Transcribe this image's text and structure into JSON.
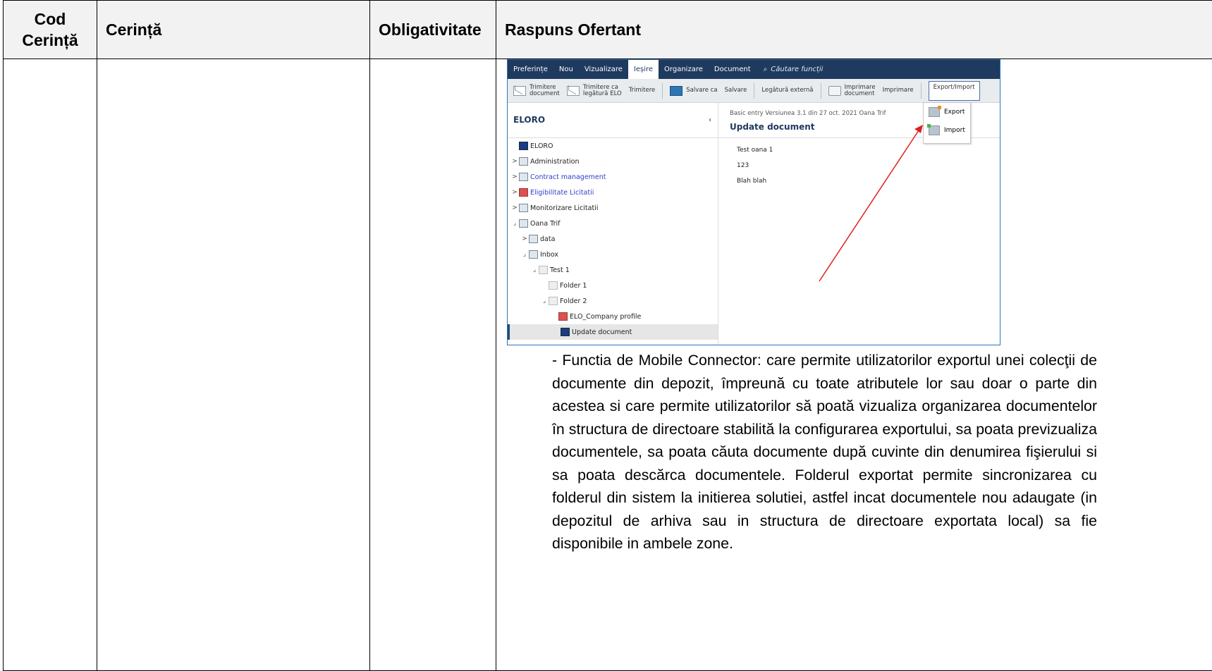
{
  "table": {
    "headers": [
      "Cod\nCerință",
      "Cerință",
      "Obligativitate",
      "Raspuns Ofertant"
    ]
  },
  "screenshot": {
    "menu": [
      "Preferințe",
      "Nou",
      "Vizualizare",
      "Ieșire",
      "Organizare",
      "Document"
    ],
    "search_placeholder": "Căutare funcții",
    "ribbon": {
      "send_doc": [
        "Trimitere",
        "document"
      ],
      "send_link": [
        "Trimitere ca",
        "legătură ELO"
      ],
      "send": "Trimitere",
      "save_as": "Salvare ca",
      "save": "Salvare",
      "ext_link": "Legătură externă",
      "print_doc": [
        "Imprimare",
        "document"
      ],
      "print": "Imprimare",
      "export_import": "Export/Import"
    },
    "dropdown": [
      "Export",
      "Import"
    ],
    "left_title": "ELORO",
    "tree": [
      {
        "label": "ELORO",
        "indent": 0,
        "arrow": "",
        "icon": "blue",
        "link": false
      },
      {
        "label": "Administration",
        "indent": 0,
        "arrow": ">",
        "icon": "",
        "link": false
      },
      {
        "label": "Contract management",
        "indent": 0,
        "arrow": ">",
        "icon": "",
        "link": true
      },
      {
        "label": "Eligibilitate Licitatii",
        "indent": 0,
        "arrow": ">",
        "icon": "red",
        "link": true
      },
      {
        "label": "Monitorizare Licitatii",
        "indent": 0,
        "arrow": ">",
        "icon": "",
        "link": false
      },
      {
        "label": "Oana Trif",
        "indent": 0,
        "arrow": "⌟",
        "icon": "",
        "link": false
      },
      {
        "label": "data",
        "indent": 1,
        "arrow": ">",
        "icon": "",
        "link": false
      },
      {
        "label": "Inbox",
        "indent": 1,
        "arrow": "⌟",
        "icon": "",
        "link": false
      },
      {
        "label": "Test 1",
        "indent": 2,
        "arrow": "⌟",
        "icon": "grey",
        "link": false
      },
      {
        "label": "Folder 1",
        "indent": 3,
        "arrow": "",
        "icon": "grey",
        "link": false
      },
      {
        "label": "Folder 2",
        "indent": 3,
        "arrow": "⌟",
        "icon": "grey",
        "link": false
      },
      {
        "label": "ELO_Company profile",
        "indent": 4,
        "arrow": "",
        "icon": "red",
        "link": false
      },
      {
        "label": "Update document",
        "indent": 4,
        "arrow": "",
        "icon": "blue",
        "link": false,
        "selected": true
      }
    ],
    "meta": "Basic entry Versiunea 3.1 din 27 oct. 2021 Oana Trif",
    "doc_title": "Update document",
    "values": [
      "Test oana 1",
      "123",
      "Blah blah"
    ]
  },
  "paragraph": "- Functia de Mobile Connector: care permite utilizatorilor exportul unei colecţii de documente din depozit, împreună cu toate atributele lor sau doar o parte din acestea si care permite utilizatorilor să poată vizualiza organizarea documentelor în structura de directoare stabilită la configurarea exportului, sa poata previzualiza documentele, sa poata căuta documente după cuvinte din denumirea fişierului si sa poata descărca documentele. Folderul exportat permite sincronizarea cu folderul din sistem la initierea solutiei, astfel incat documentele nou adaugate (in depozitul de arhiva sau in structura de directoare exportata local) sa fie disponibile in ambele zone."
}
